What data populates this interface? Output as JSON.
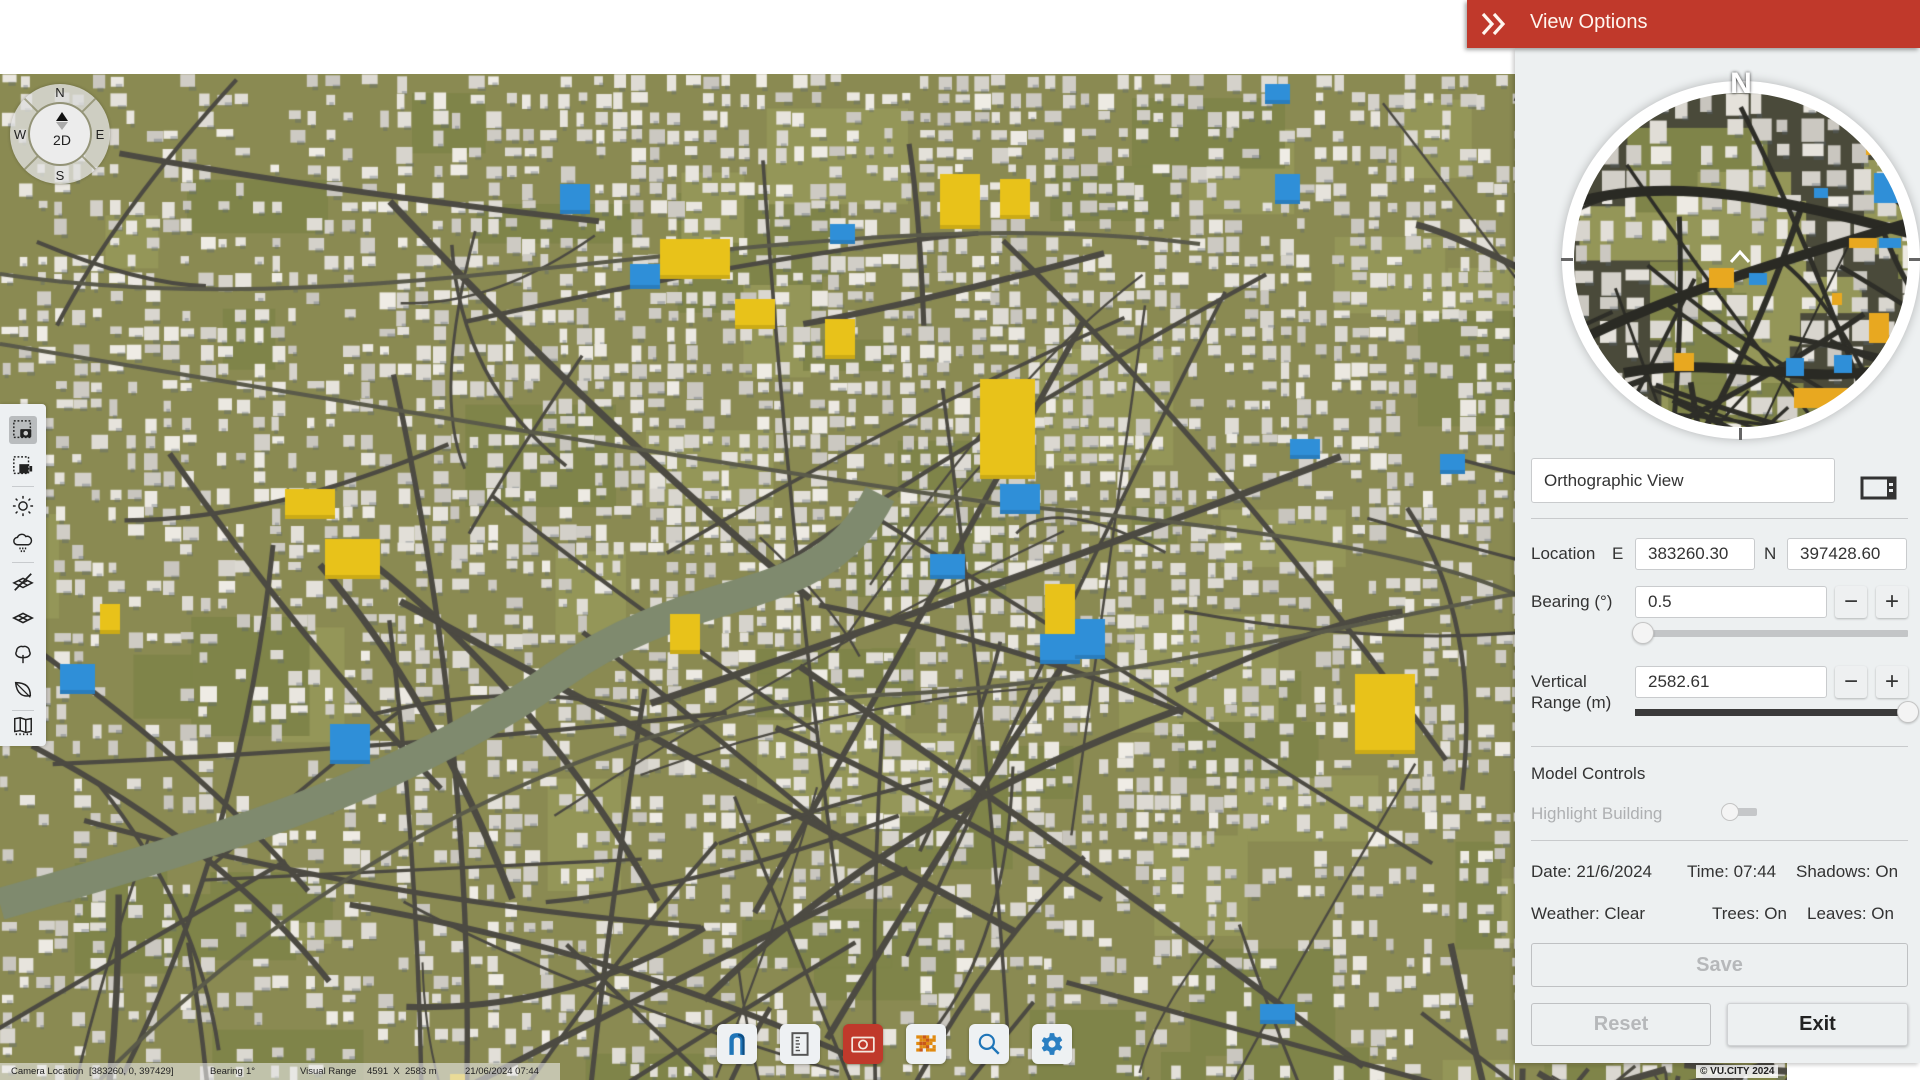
{
  "compass": {
    "north": "N",
    "south": "S",
    "east": "E",
    "west": "W",
    "mode": "2D"
  },
  "left_toolbar": {
    "items": [
      {
        "name": "area-capture",
        "icon": "camera-select-icon",
        "active": true
      },
      {
        "name": "video-capture",
        "icon": "video-select-icon",
        "active": false
      },
      {
        "name": "sun",
        "icon": "sun-icon",
        "active": false
      },
      {
        "name": "weather",
        "icon": "cloud-rain-icon",
        "active": false
      },
      {
        "name": "hide-layer",
        "icon": "layer-off-icon",
        "active": false
      },
      {
        "name": "layers",
        "icon": "layers-icon",
        "active": false
      },
      {
        "name": "trees",
        "icon": "tree-icon",
        "active": false
      },
      {
        "name": "leaves",
        "icon": "leaf-icon",
        "active": false
      },
      {
        "name": "map",
        "icon": "map-icon",
        "active": false
      }
    ]
  },
  "bottom_toolbar": {
    "items": [
      {
        "name": "vu-city",
        "icon": "vucity-logo-icon",
        "active": false
      },
      {
        "name": "document",
        "icon": "document-icon",
        "active": false
      },
      {
        "name": "camera",
        "icon": "camera-icon",
        "active": true
      },
      {
        "name": "pixel-tool",
        "icon": "pixel-grid-icon",
        "active": false
      },
      {
        "name": "search",
        "icon": "search-icon",
        "active": false
      },
      {
        "name": "settings",
        "icon": "gear-icon",
        "active": false
      }
    ]
  },
  "status_bar": {
    "camera_location_label": "Camera Location",
    "camera_location_value": "[383260, 0, 397429]",
    "bearing_label": "Bearing",
    "bearing_value": "1°",
    "visual_range_label": "Visual Range",
    "visual_range_value": "4591  X  2583 m",
    "datetime": "21/06/2024 07:44"
  },
  "copyright": "© VU.CITY 2024",
  "panel": {
    "title": "View Options",
    "minimap_north": "N",
    "view_type": "Orthographic View",
    "location": {
      "label": "Location",
      "e_label": "E",
      "e_value": "383260.30",
      "n_label": "N",
      "n_value": "397428.60"
    },
    "bearing": {
      "label": "Bearing (°)",
      "value": "0.5",
      "minus": "−",
      "plus": "+",
      "slider_fraction": 0.0
    },
    "vertical_range": {
      "label_line1": "Vertical",
      "label_line2": "Range (m)",
      "value": "2582.61",
      "minus": "−",
      "plus": "+",
      "slider_fraction": 1.0
    },
    "model_controls": {
      "heading": "Model Controls",
      "highlight_label": "Highlight Building",
      "highlight_on": false
    },
    "info": {
      "date": "Date: 21/6/2024",
      "time": "Time: 07:44",
      "shadows": "Shadows: On",
      "weather": "Weather: Clear",
      "trees": "Trees: On",
      "leaves": "Leaves: On"
    },
    "buttons": {
      "save": "Save",
      "reset": "Reset",
      "exit": "Exit"
    }
  },
  "colors": {
    "accent": "#c0392b",
    "highlight_yellow": "#e8c21a",
    "highlight_blue": "#2f8fd8",
    "panel_bg": "#edf0f1"
  }
}
